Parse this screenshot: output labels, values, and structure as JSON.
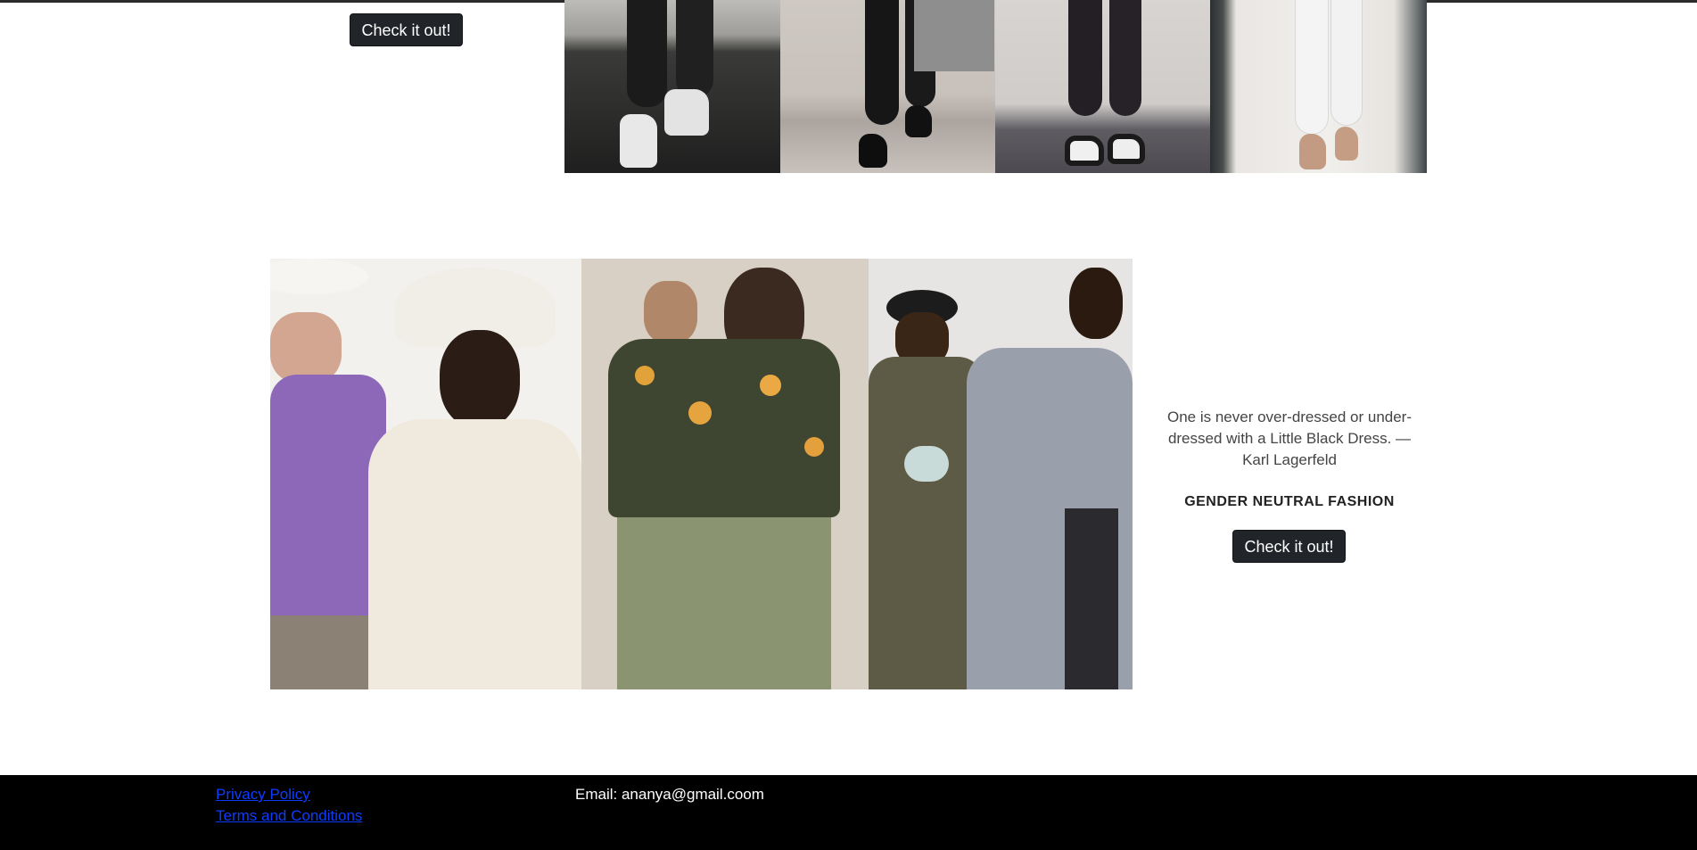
{
  "top_section": {
    "button_label": "Check it out!"
  },
  "gender_section": {
    "quote": "One is never over-dressed or under-dressed with a Little Black Dress. — Karl Lagerfeld",
    "title": "GENDER NEUTRAL FASHION",
    "button_label": "Check it out!"
  },
  "footer": {
    "privacy_label": "Privacy Policy",
    "terms_label": "Terms and Conditions",
    "email_text": "Email: ananya@gmail.coom"
  },
  "colors": {
    "button_bg": "#212529",
    "footer_bg": "#000000",
    "link": "#0d3cff"
  }
}
